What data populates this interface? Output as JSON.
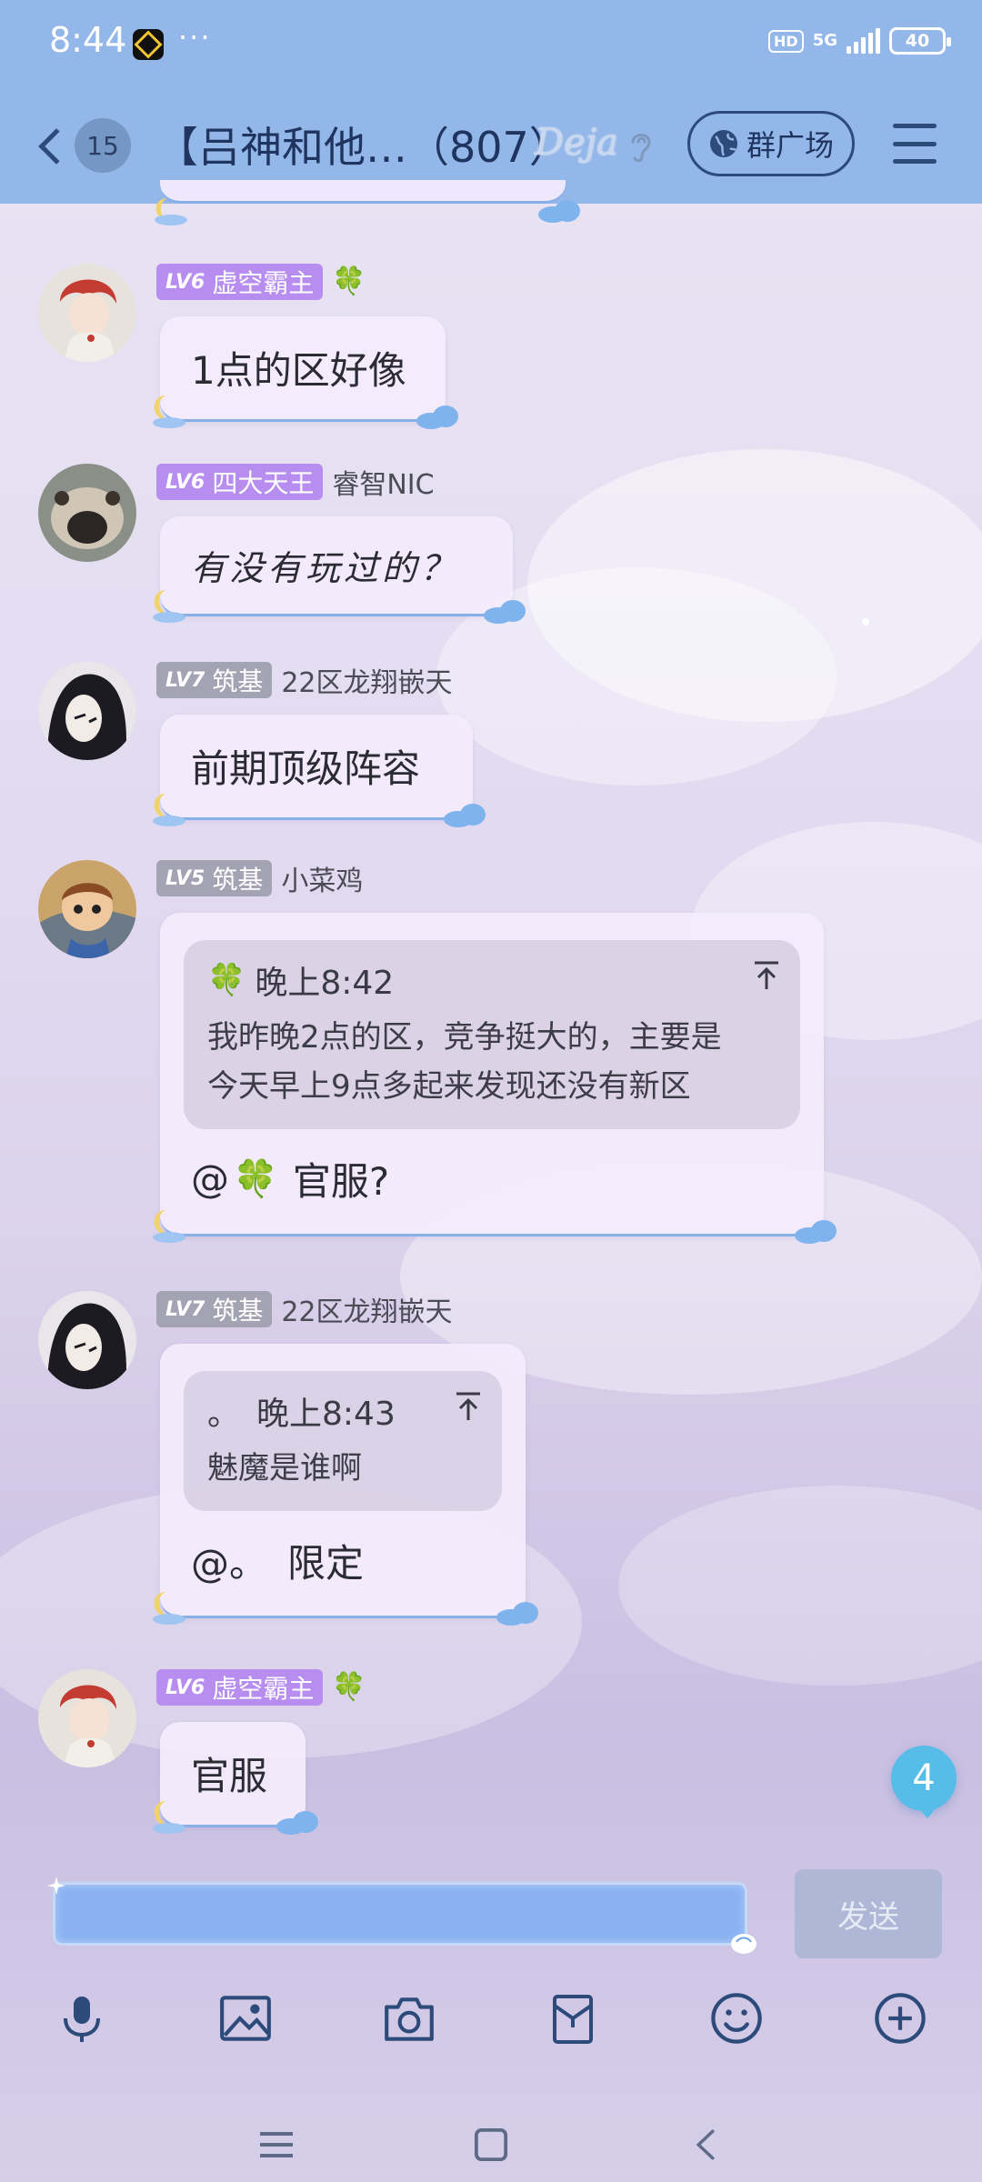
{
  "status_bar": {
    "time": "8:44",
    "more": "···",
    "hd": "HD",
    "network": "5G",
    "battery": "40"
  },
  "header": {
    "unread_count": "15",
    "title": "【吕神和他…（807）",
    "title_deco": "Deja",
    "square_label": "群广场"
  },
  "messages": [
    {
      "level": "LV6",
      "title": "虚空霸主",
      "nick": "",
      "text": "1点的区好像"
    },
    {
      "level": "LV6",
      "title": "四大天王",
      "nick": "睿智NIC",
      "text": "有没有玩过的？"
    },
    {
      "level": "LV7",
      "title": "筑基",
      "nick": "22区龙翔嵌天",
      "text": "前期顶级阵容"
    },
    {
      "level": "LV5",
      "title": "筑基",
      "nick": "小菜鸡",
      "quote": {
        "time": "晚上8:42",
        "line1": "我昨晚2点的区，竞争挺大的，主要是",
        "line2": "今天早上9点多起来发现还没有新区"
      },
      "text": "官服?"
    },
    {
      "level": "LV7",
      "title": "筑基",
      "nick": "22区龙翔嵌天",
      "quote": {
        "author": "。",
        "time": "晚上8:43",
        "line1": "魅魔是谁啊"
      },
      "mention": "@。",
      "text": "限定"
    },
    {
      "level": "LV6",
      "title": "虚空霸主",
      "nick": "",
      "text": "官服"
    }
  ],
  "mention_prefix": "@",
  "floating_unread": "4",
  "input": {
    "value": "",
    "send_label": "发送"
  },
  "toolbar_icons": [
    "microphone-icon",
    "image-icon",
    "camera-icon",
    "red-packet-icon",
    "emoji-icon",
    "plus-icon"
  ],
  "colors": {
    "header_bg": "#93b7e9",
    "level_purple": "#b78ef0",
    "level_gray": "#a3a3b4",
    "input_bg": "#8ab2f2",
    "unread_badge": "#56bde9"
  }
}
